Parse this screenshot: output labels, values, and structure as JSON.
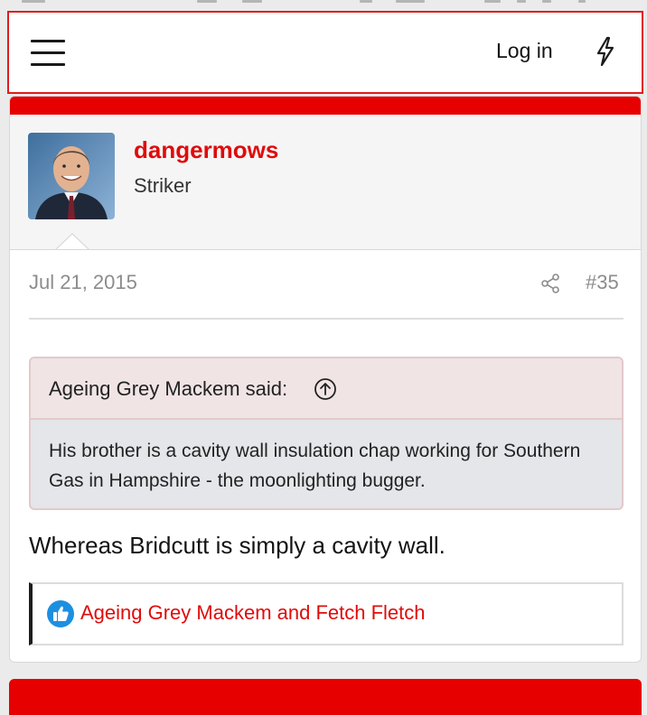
{
  "header": {
    "login_label": "Log in"
  },
  "icons": {
    "menu": "hamburger-menu-icon",
    "whats_new": "lightning-bolt-icon",
    "share": "share-icon",
    "quote_jump": "arrow-up-circle-icon",
    "like": "thumbs-up-icon"
  },
  "post": {
    "author": "dangermows",
    "author_title": "Striker",
    "date": "Jul 21, 2015",
    "number": "#35",
    "quote": {
      "author": "Ageing Grey Mackem said:",
      "text": "His brother is a cavity wall insulation chap working for Southern Gas in Hampshire - the moonlighting bugger."
    },
    "body": "Whereas Bridcutt is simply a cavity wall.",
    "reactions": "Ageing Grey Mackem and Fetch Fletch"
  },
  "colors": {
    "brand_red": "#e60000",
    "link_red": "#e00b0b",
    "like_blue": "#1d8fe1",
    "quote_border": "#e3c9cb",
    "quote_head_bg": "#f0e4e5",
    "quote_body_bg": "#e4e6e9"
  }
}
